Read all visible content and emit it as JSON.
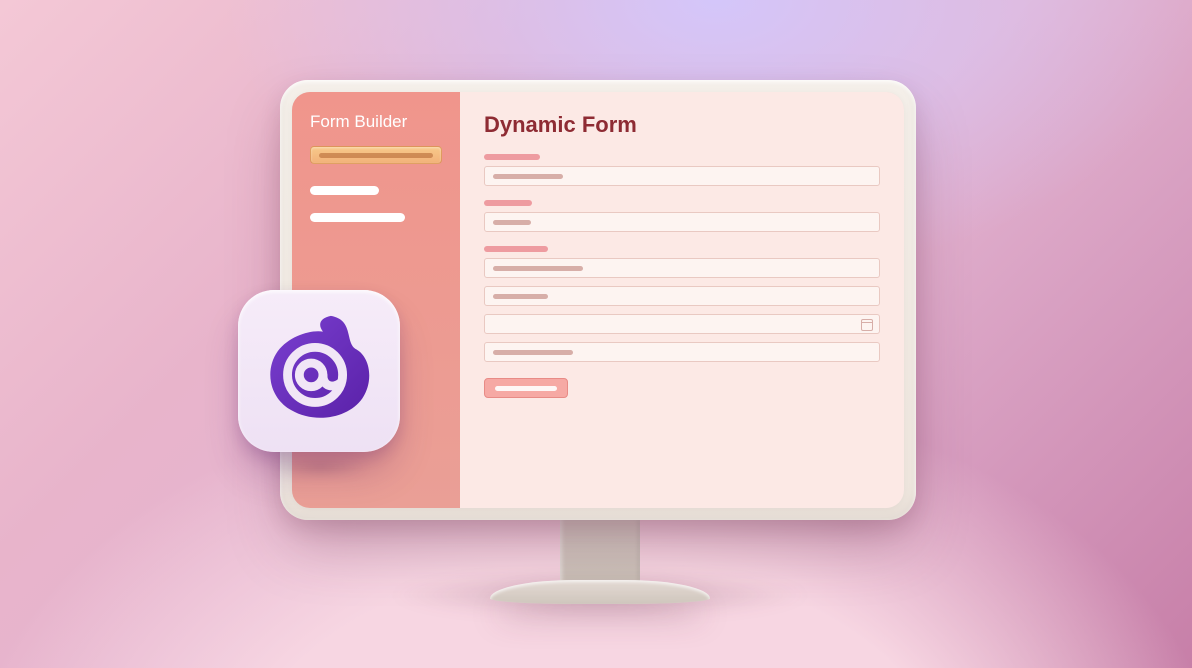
{
  "sidebar": {
    "title": "Form Builder",
    "items": [
      {
        "active": true
      },
      {
        "active": false
      },
      {
        "active": false
      }
    ]
  },
  "main": {
    "title": "Dynamic Form",
    "fields": [
      {
        "type": "text"
      },
      {
        "type": "text"
      },
      {
        "type": "group",
        "inputs": 4,
        "has_date": true
      },
      {
        "type": "submit"
      }
    ]
  },
  "logo": {
    "name": "blazor-icon",
    "color": "#6b2fb5"
  },
  "colors": {
    "sidebar_bg": "#ee9990",
    "panel_bg": "#fce9e5",
    "title_text": "#8e2b33",
    "accent_pill": "#f5bd85",
    "field_label": "#ee9ba0",
    "submit_bg": "#f6a9a4"
  }
}
